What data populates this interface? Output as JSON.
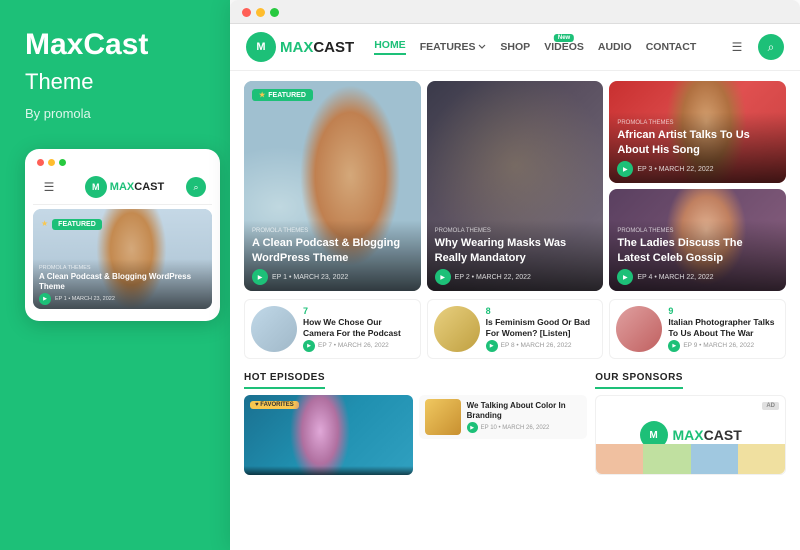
{
  "left": {
    "title": "MaxCast",
    "subtitle": "Theme",
    "by": "By promola",
    "mobile_logo": "MAX",
    "mobile_logo_text": "MAX",
    "mobile_featured_label": "FEATURED",
    "mobile_hero_tag": "PROMOLA THEMES",
    "mobile_hero_title": "A Clean Podcast & Blogging WordPress Theme",
    "mobile_ep": "EP 1",
    "mobile_date": "MARCH 23, 2022"
  },
  "header": {
    "logo_text": "MAX",
    "logo_full": "CAST",
    "nav_home": "HOME",
    "nav_features": "FEATURES",
    "nav_shop": "SHOP",
    "nav_videos": "VIDEOS",
    "nav_new_badge": "New",
    "nav_audio": "AUDIO",
    "nav_contact": "CONTACT"
  },
  "cards": {
    "featured_badge": "FEATURED",
    "card1": {
      "tag": "PROMOLA THEMES",
      "title": "A Clean Podcast & Blogging WordPress Theme",
      "ep": "EP 1",
      "date": "MARCH 23, 2022"
    },
    "card2": {
      "tag": "PROMOLA THEMES",
      "title": "Why Wearing Masks Was Really Mandatory",
      "ep": "EP 2",
      "date": "MARCH 22, 2022"
    },
    "card3": {
      "tag": "PROMOLA THEMES",
      "title": "African Artist Talks To Us About His Song",
      "ep": "EP 3",
      "date": "MARCH 22, 2022"
    },
    "card4": {
      "tag": "PROMOLA THEMES",
      "title": "The Ladies Discuss The Latest Celeb Gossip",
      "ep": "EP 4",
      "date": "MARCH 22, 2022"
    }
  },
  "small_cards": {
    "card1": {
      "num": "7",
      "title": "How We Chose Our Camera For the Podcast",
      "ep": "EP 7",
      "date": "MARCH 26, 2022"
    },
    "card2": {
      "num": "8",
      "title": "Is Feminism Good Or Bad For Women? [Listen]",
      "ep": "EP 8",
      "date": "MARCH 26, 2022"
    },
    "card3": {
      "num": "9",
      "title": "Italian Photographer Talks To Us About The War",
      "ep": "EP 9",
      "date": "MARCH 26, 2022"
    }
  },
  "hot_episodes": {
    "section_title": "HOT EPISODES",
    "badge": "♥ FAVORITES",
    "card1_title": "We Talking About Color In Branding",
    "card1_ep": "EP 10",
    "card1_date": "MARCH 26, 2022"
  },
  "sponsors": {
    "section_title": "OUR SPONSORS",
    "ad_label": "AD",
    "logo_icon": "M",
    "logo_text": "CAST"
  }
}
